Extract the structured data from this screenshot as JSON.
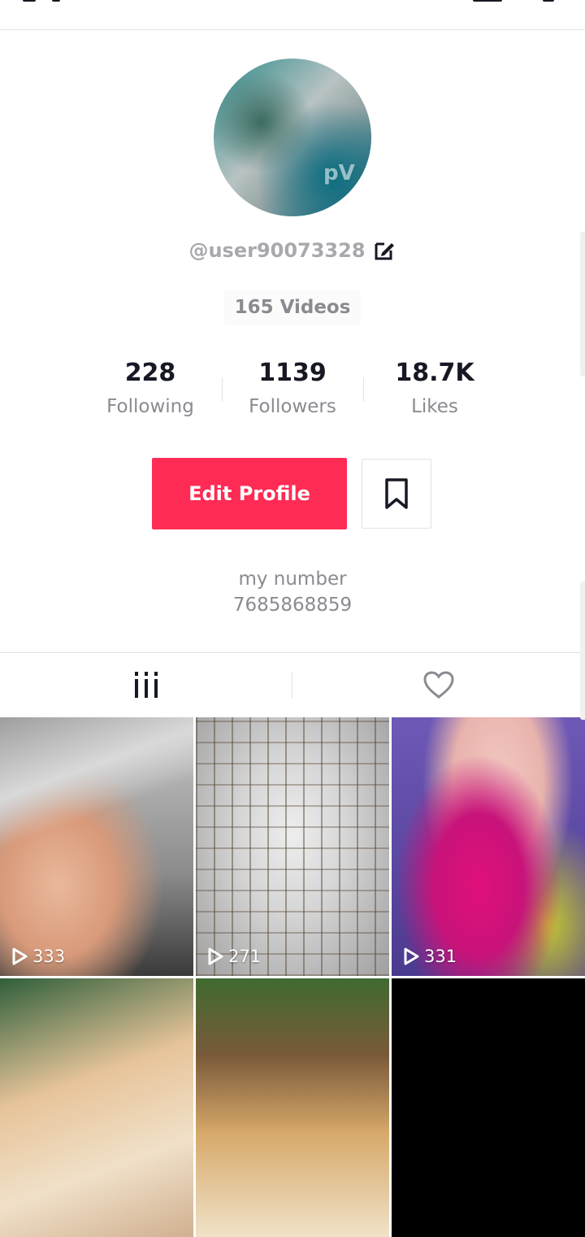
{
  "profile": {
    "username": "@user90073328",
    "videos_label": "165 Videos",
    "stats": [
      {
        "value": "228",
        "label": "Following"
      },
      {
        "value": "1139",
        "label": "Followers"
      },
      {
        "value": "18.7K",
        "label": "Likes"
      }
    ],
    "edit_profile_label": "Edit Profile",
    "bio_lines": [
      "my number",
      "7685868859"
    ]
  },
  "videos": [
    {
      "views": "333"
    },
    {
      "views": "271"
    },
    {
      "views": "331"
    },
    {
      "views": ""
    },
    {
      "views": ""
    },
    {
      "views": ""
    }
  ],
  "colors": {
    "accent": "#fe2c55",
    "muted_text": "#8a8b91",
    "divider": "#e3e3e4"
  },
  "icons": [
    "edit-icon",
    "bookmark-icon",
    "grid-icon",
    "heart-icon",
    "play-icon"
  ]
}
